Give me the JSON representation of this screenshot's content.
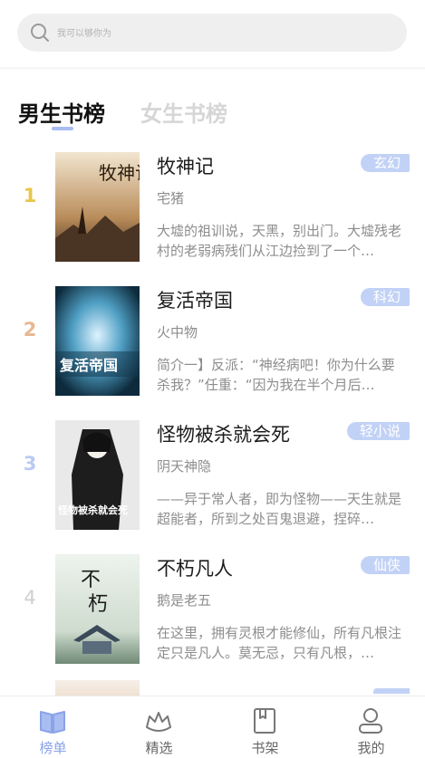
{
  "search": {
    "placeholder": "我可以够你为"
  },
  "tabs": [
    {
      "label": "男生书榜",
      "active": true
    },
    {
      "label": "女生书榜",
      "active": false
    }
  ],
  "books": [
    {
      "rank": "1",
      "rank_color": "#e9c64a",
      "title": "牧神记",
      "author": "宅猪",
      "desc": "大墟的祖训说，天黑，别出门。大墟残老村的老弱病残们从江边捡到了一个…",
      "tag": "玄幻",
      "cover_text": "牧神记"
    },
    {
      "rank": "2",
      "rank_color": "#e8b893",
      "title": "复活帝国",
      "author": "火中物",
      "desc": "简介一】反派：“神经病吧！你为什么要杀我？”任重：“因为我在半个月后…",
      "tag": "科幻",
      "cover_text": "复活帝国"
    },
    {
      "rank": "3",
      "rank_color": "#b9cbf2",
      "title": "怪物被杀就会死",
      "author": "阴天神隐",
      "desc": "——异于常人者，即为怪物——天生就是超能者，所到之处百鬼退避，捏碎…",
      "tag": "轻小说",
      "cover_text": "怪物被杀就会死"
    },
    {
      "rank": "4",
      "rank_color": "#cfcfcf",
      "title": "不朽凡人",
      "author": "鹅是老五",
      "desc": "在这里，拥有灵根才能修仙，所有凡根注定只是凡人。莫无忌，只有凡根，…",
      "tag": "仙侠",
      "cover_text": "不朽凡人"
    }
  ],
  "nav": [
    {
      "label": "榜单",
      "icon": "book-open-icon",
      "active": true
    },
    {
      "label": "精选",
      "icon": "crown-icon",
      "active": false
    },
    {
      "label": "书架",
      "icon": "bookshelf-icon",
      "active": false
    },
    {
      "label": "我的",
      "icon": "user-icon",
      "active": false
    }
  ],
  "colors": {
    "accent": "#8aa3e8",
    "tag_bg": "#c2d2f6"
  }
}
